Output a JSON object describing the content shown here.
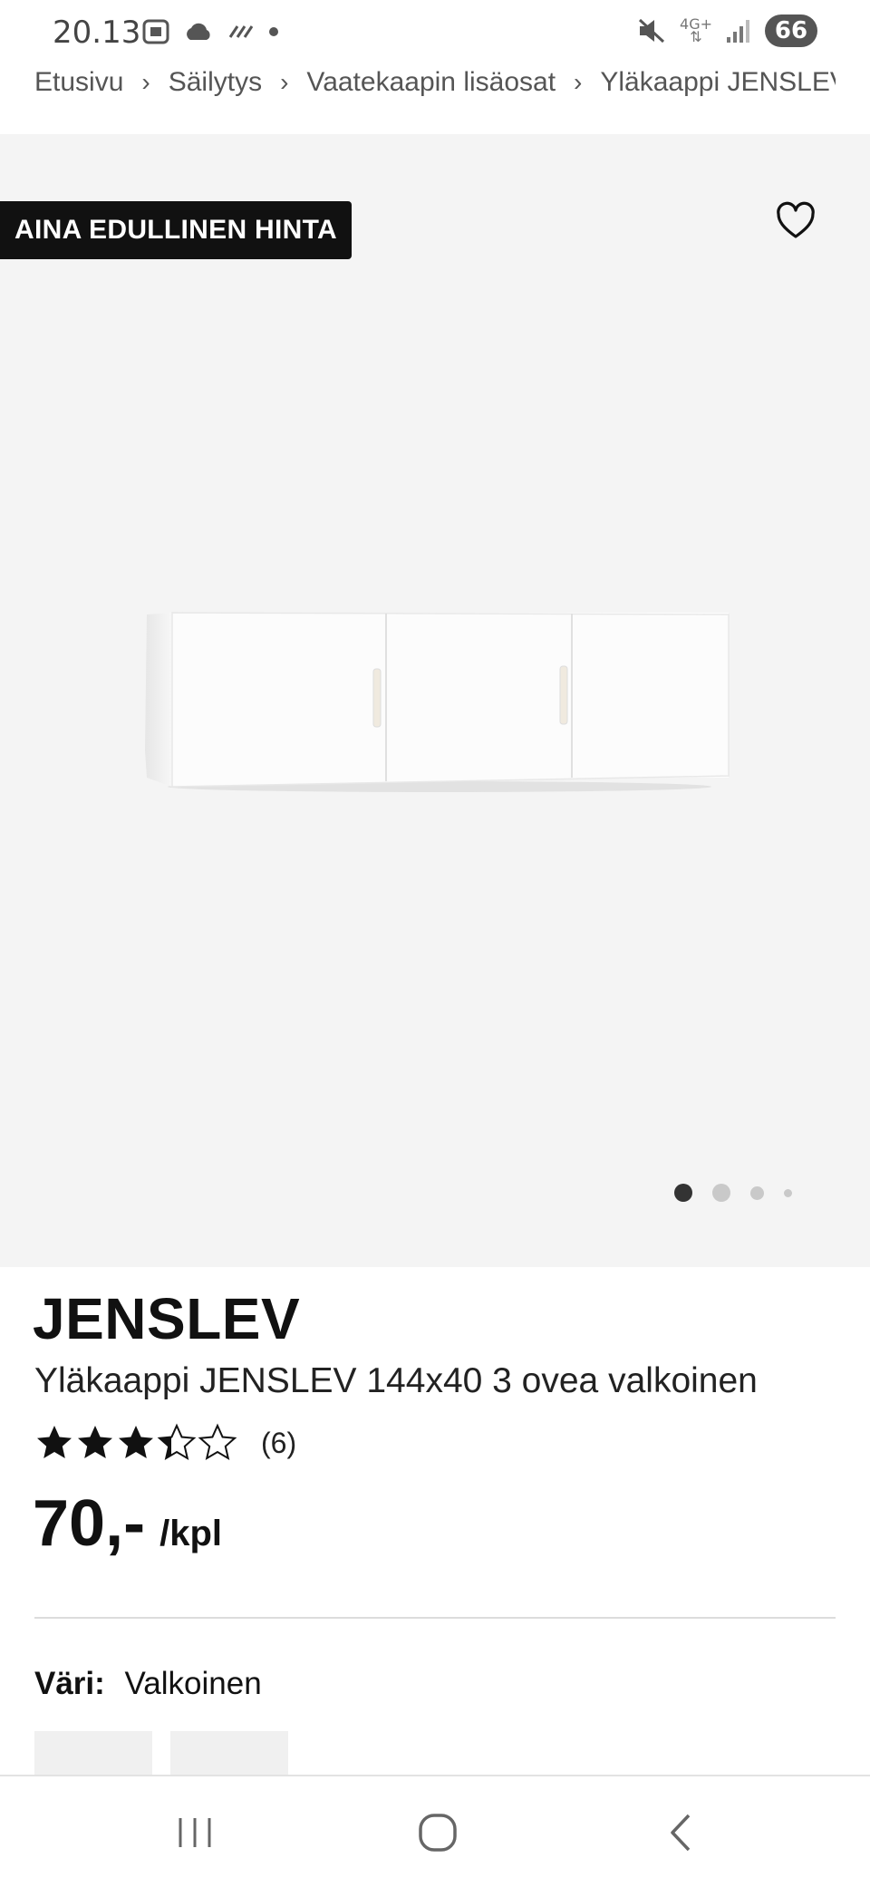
{
  "status_bar": {
    "time": "20.13",
    "network": "4G+",
    "battery": "66",
    "icons": [
      "screenshot-icon",
      "cloud-icon",
      "data-icon",
      "dot-icon",
      "mute-icon",
      "signal-icon",
      "battery-icon"
    ]
  },
  "breadcrumb": [
    "Etusivu",
    "Säilytys",
    "Vaatekaapin lisäosat",
    "Yläkaappi JENSLEV"
  ],
  "hero": {
    "badge": "AINA EDULLINEN HINTA",
    "image_count": 4,
    "active_image": 1
  },
  "product": {
    "brand": "JENSLEV",
    "name": "Yläkaappi JENSLEV 144x40 3 ovea valkoinen",
    "rating": 3.7,
    "rating_max": 5,
    "review_count": "(6)",
    "price": "70,-",
    "price_unit": "/kpl",
    "color_label": "Väri:",
    "color_value": "Valkoinen"
  },
  "colors": {
    "badge_bg": "#111111",
    "hero_bg": "#f4f4f4",
    "star": "#111111"
  }
}
